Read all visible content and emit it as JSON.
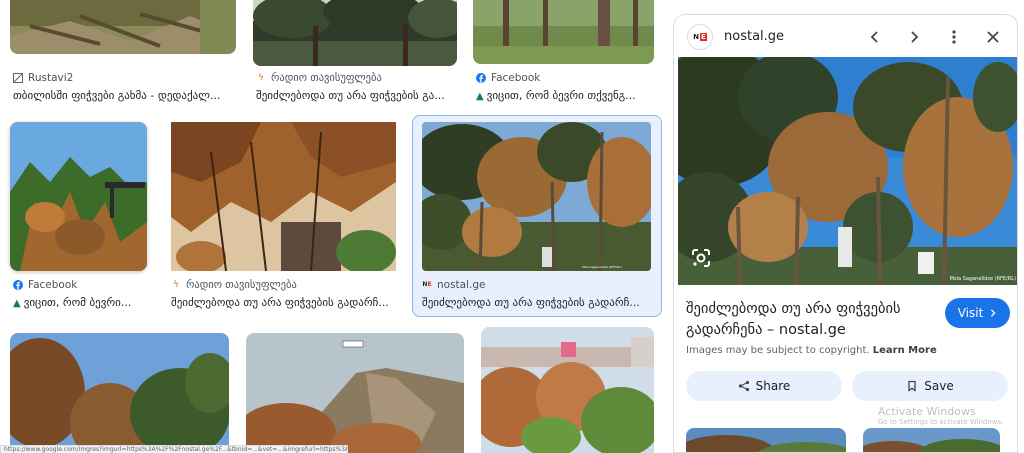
{
  "results": [
    {
      "source": "Rustavi2",
      "source_icon": "rustavi-icon",
      "title": "თბილისში ფიჭვები გახმა - დედაქალ..."
    },
    {
      "source": "რადიო თავისუფლება",
      "source_icon": "radio-liberty-icon",
      "title": "შეიძლებოდა თუ არა ფიჭვების გა..."
    },
    {
      "source": "Facebook",
      "source_icon": "facebook-icon",
      "title": "ვიცით, რომ ბევრი თქვენგ..."
    },
    {
      "source": "Facebook",
      "source_icon": "facebook-icon",
      "title": "ვიცით, რომ ბევრი..."
    },
    {
      "source": "რადიო თავისუფლება",
      "source_icon": "radio-liberty-icon",
      "title": "შეიძლებოდა თუ არა ფიჭვების გადარჩ..."
    },
    {
      "source": "nostal.ge",
      "source_icon": "nostal-icon",
      "title": "შეიძლებოდა თუ არა ფიჭვების გადარჩ..."
    }
  ],
  "status_url": "https://www.google.com/imgres?imgurl=https%3A%2F%2Fnostal.ge%2F...&tbnid=...&vet=...&imgrefurl=https%3A%2F%2Fnostal.ge%2F&docid=...&w=1200&h=800&hl=ka&lookside.fbsbx.com%...",
  "panel": {
    "site": "nostal.ge",
    "logo_n": "N",
    "logo_e": "E",
    "title": "შეიძლებოდა თუ არა ფიჭვების გადარჩენა – nostal.ge",
    "visit_label": "Visit",
    "copyright_text": "Images may be subject to copyright.",
    "learn_more": "Learn More",
    "share_label": "Share",
    "save_label": "Save",
    "image_credit": "Mzia Saganelidze (RFE/RL)"
  },
  "watermark": {
    "line1": "Activate Windows",
    "line2": "Go to Settings to activate Windows."
  },
  "colors": {
    "accent": "#1a73e8",
    "selected_bg": "#e8f0fe",
    "selected_border": "#8ab4f8",
    "facebook": "#1877f2",
    "radio_liberty": "#e8710a"
  }
}
